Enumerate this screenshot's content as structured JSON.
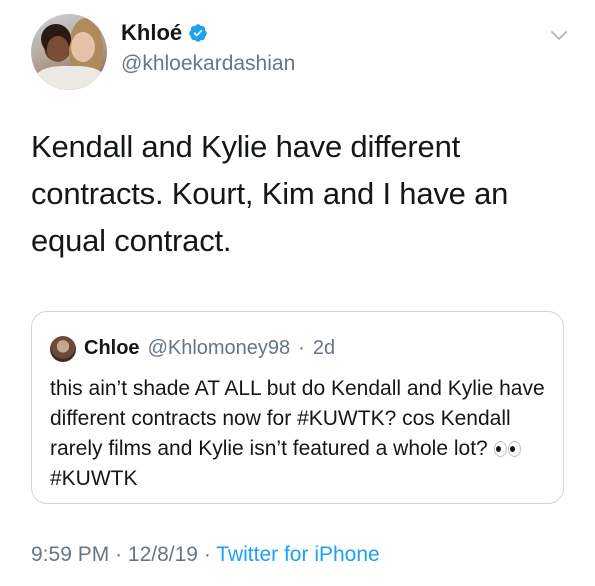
{
  "author": {
    "name": "Khloé",
    "handle": "@khloekardashian",
    "verified": true
  },
  "tweet": {
    "text": "Kendall and Kylie have different contracts. Kourt, Kim and I have an equal contract."
  },
  "quoted_tweet": {
    "name": "Chloe",
    "handle": "@Khlomoney98",
    "separator": "·",
    "age": "2d",
    "text_before_emoji": "this ain’t shade AT ALL but do Kendall and Kylie have different contracts now for #KUWTK? cos Kendall rarely films and Kylie isn’t featured a whole lot?",
    "emoji": "eyes",
    "text_after_emoji": "#KUWTK"
  },
  "footer": {
    "time": "9:59 PM",
    "sep1": "·",
    "date": "12/8/19",
    "sep2": "·",
    "source": "Twitter for iPhone"
  },
  "colors": {
    "text": "#14171a",
    "secondary": "#657786",
    "link": "#1da1f2",
    "border": "#ccd6dd"
  },
  "icons": [
    "verified-badge-icon",
    "chevron-down-icon",
    "eyes-emoji"
  ]
}
